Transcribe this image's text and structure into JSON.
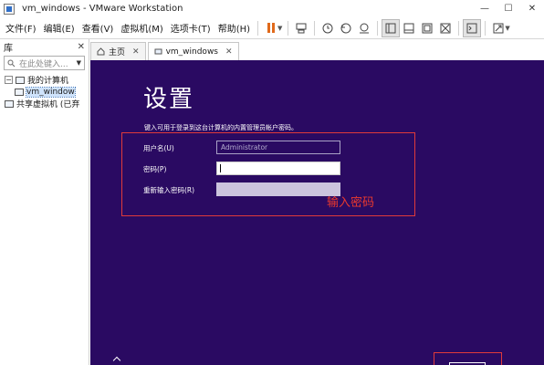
{
  "window": {
    "title": "vm_windows - VMware Workstation",
    "controls": {
      "minimize": "—",
      "maximize": "☐",
      "close": "✕"
    }
  },
  "menu": {
    "items": [
      "文件(F)",
      "编辑(E)",
      "查看(V)",
      "虚拟机(M)",
      "选项卡(T)",
      "帮助(H)"
    ]
  },
  "toolbar": {
    "icons": [
      "pause-icon",
      "send-keys-icon",
      "snapshot-icon",
      "revert-snapshot-icon",
      "snapshot-manager-icon",
      "library-view-icon",
      "thumbnail-view-icon",
      "fullscreen-vm-icon",
      "unity-icon",
      "console-icon",
      "fit-window-icon"
    ],
    "accent": "#e06a1b"
  },
  "library": {
    "title": "库",
    "close": "✕",
    "search_placeholder": "在此处键入...",
    "tree": {
      "my_computer": "我的计算机",
      "vm_item": "vm_window",
      "shared_vms": "共享虚拟机 (已弃"
    }
  },
  "tabs": [
    {
      "label": "主页",
      "close": "✕"
    },
    {
      "label": "vm_windows",
      "close": "✕"
    }
  ],
  "guest": {
    "title": "设置",
    "description": "键入可用于登录到这台计算机的内置管理员帐户密码。",
    "username_label": "用户名(U)",
    "username_value": "Administrator",
    "password_label": "密码(P)",
    "repeat_label": "重新输入密码(R)",
    "annotation": "输入密码",
    "background_color": "#2a0a62",
    "annotation_color": "#e8392f"
  }
}
